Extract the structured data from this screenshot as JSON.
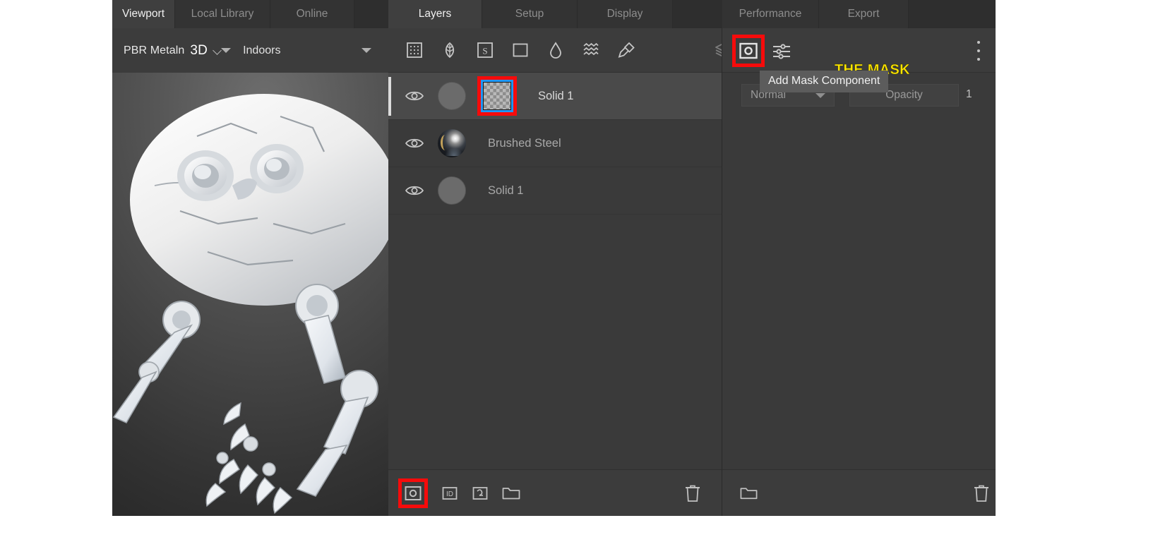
{
  "left_tabs": [
    {
      "label": "Viewport",
      "active": true
    },
    {
      "label": "Local Library",
      "active": false
    },
    {
      "label": "Online",
      "active": false
    }
  ],
  "mid_tabs": [
    {
      "label": "Layers",
      "active": true
    },
    {
      "label": "Setup",
      "active": false
    },
    {
      "label": "Display",
      "active": false
    }
  ],
  "right_tabs": [
    {
      "label": "Performance",
      "active": false
    },
    {
      "label": "Export",
      "active": false
    }
  ],
  "viewport_toolbar": {
    "material_name": "PBR Metaln",
    "mode": "3D",
    "environment": "Indoors",
    "chevron_icon": "chevron-down-icon",
    "dropdown_icon": "triangle-down-icon",
    "grid_icon": "grid-view-icon"
  },
  "layers_toolbar": {
    "icons": [
      "texture-grid-icon",
      "leaf-icon",
      "s-square-icon",
      "square-icon",
      "droplet-icon",
      "waves-icon",
      "paintbrush-icon"
    ],
    "stack_icon": "layers-stack-icon"
  },
  "annotation": {
    "mask_label": "THE MASK",
    "mask_label_color": "#ffe600",
    "highlight_color": "#f60b0b",
    "selection_color": "#2196f3"
  },
  "layers": [
    {
      "name": "Solid 1",
      "visible": true,
      "selected": true,
      "thumb": "solid-gray-circle",
      "has_mask": true,
      "mask_thumb": "checkerboard-transparent"
    },
    {
      "name": "Brushed Steel",
      "visible": true,
      "selected": false,
      "thumb": "brushed-steel-sphere",
      "has_mask": false
    },
    {
      "name": "Solid 1",
      "visible": true,
      "selected": false,
      "thumb": "solid-gray-circle",
      "has_mask": false
    }
  ],
  "layers_bottom_bar": {
    "icons": [
      "add-mask-icon",
      "add-id-icon",
      "add-curve-icon",
      "add-folder-icon"
    ],
    "trash_icon": "trash-icon",
    "highlighted": "add-mask-icon"
  },
  "right_panel": {
    "mask_button_icon": "add-mask-icon",
    "sliders_icon": "sliders-icon",
    "overflow_icon": "more-vertical-icon",
    "tooltip": "Add Mask Component",
    "blend_mode": "Normal",
    "blend_chevron_icon": "triangle-down-icon",
    "opacity_label": "Opacity",
    "opacity_value": "1",
    "folder_icon": "folder-icon",
    "trash_icon": "trash-icon"
  },
  "eye_icon": "eye-visible-icon"
}
